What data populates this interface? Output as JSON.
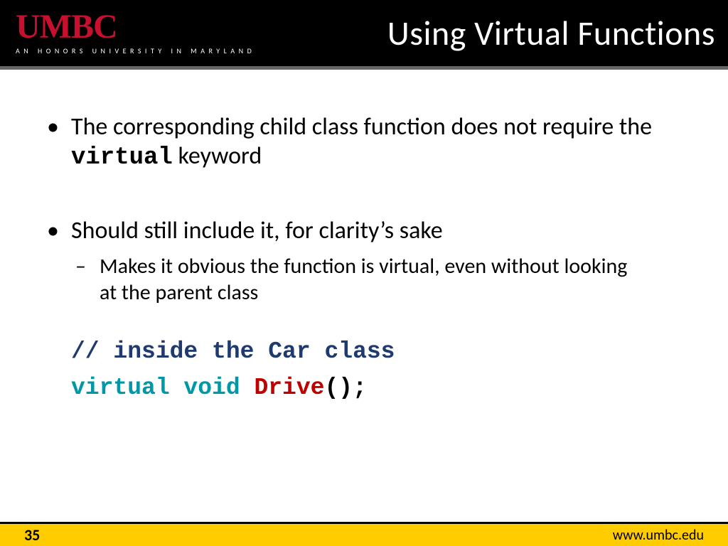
{
  "header": {
    "logo": "UMBC",
    "logo_sub": "AN HONORS UNIVERSITY IN MARYLAND",
    "title": "Using Virtual Functions"
  },
  "bullets": {
    "b1_pre": "The corresponding child class function does not require the ",
    "b1_mono": "virtual",
    "b1_post": " keyword",
    "b2": "Should still include it, for clarity’s sake",
    "b2_sub": "Makes it obvious the function is virtual, even without looking at the parent class"
  },
  "code": {
    "comment": "// inside the Car class",
    "kw": "virtual void ",
    "fn": "Drive",
    "tail": "();"
  },
  "footer": {
    "slide_no": "35",
    "url": "www.umbc.edu"
  }
}
